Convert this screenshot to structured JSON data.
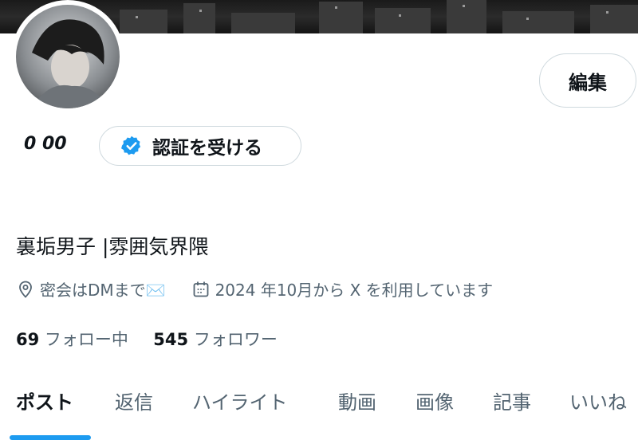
{
  "profile": {
    "display_name": "裏垢男子 |雰囲気界隈",
    "badges_text": "0 00",
    "location": "密会はDMまで✉️",
    "joined": "2024 年10月から X を利用しています"
  },
  "buttons": {
    "edit_label": "編集",
    "verify_label": "認証を受ける"
  },
  "stats": {
    "following_count": "69",
    "following_label": "フォロー中",
    "followers_count": "545",
    "followers_label": "フォロワー"
  },
  "tabs": [
    "ポスト",
    "返信",
    "ハイライト",
    "動画",
    "画像",
    "記事",
    "いいね"
  ],
  "colors": {
    "accent": "#1d9bf0",
    "muted": "#536471",
    "text": "#0f1419",
    "border": "#cfd9de"
  }
}
